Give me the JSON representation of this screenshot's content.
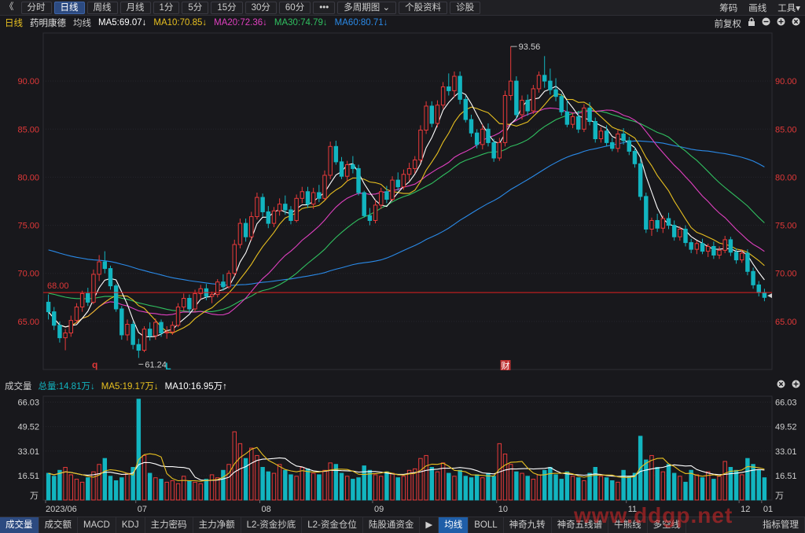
{
  "toolbar": {
    "back": "《",
    "items": [
      "分时",
      "日线",
      "周线",
      "月线",
      "1分",
      "5分",
      "15分",
      "30分",
      "60分",
      "•••",
      "多周期图 ⌄",
      "个股资料",
      "诊股"
    ],
    "active_index": 1,
    "right": [
      "筹码",
      "画线",
      "工具▾"
    ]
  },
  "legend": {
    "period": "日线",
    "stock": "药明康德",
    "avg": "均线",
    "ma5": "MA5:69.07↓",
    "ma10": "MA10:70.85↓",
    "ma20": "MA20:72.36↓",
    "ma30": "MA30:74.79↓",
    "ma60": "MA60:80.71↓",
    "adjust": "前复权",
    "lock_icon": "lock-icon",
    "icons": [
      "lock-icon",
      "minus-circle-icon",
      "plus-circle-icon",
      "close-circle-icon"
    ]
  },
  "colors": {
    "up": "#e83a3a",
    "down": "#12b5c0",
    "ma5": "#ffffff",
    "ma10": "#e8c020",
    "ma20": "#e040c0",
    "ma30": "#30c060",
    "ma60": "#2a8ae8",
    "ref_line": "#e02020"
  },
  "chart_data": [
    {
      "type": "candlestick",
      "title": "药明康德 日线",
      "y_ticks": [
        "90.00",
        "85.00",
        "80.00",
        "75.00",
        "70.00",
        "65.00"
      ],
      "ylim": [
        60,
        95
      ],
      "x_labels": [
        "2023/06",
        "07",
        "08",
        "09",
        "10",
        "11",
        "12",
        "01"
      ],
      "annotations": {
        "high": "93.56",
        "low": "61.24",
        "ref_price": "68.00",
        "marker_q": "q",
        "marker_L": "L",
        "marker_cai": "财"
      },
      "ohlc": [
        [
          67.0,
          67.8,
          65.2,
          66.0
        ],
        [
          66.0,
          66.5,
          64.1,
          64.6
        ],
        [
          64.6,
          65.0,
          62.8,
          63.3
        ],
        [
          63.3,
          64.2,
          62.0,
          63.8
        ],
        [
          63.8,
          65.6,
          63.4,
          65.1
        ],
        [
          65.1,
          66.9,
          64.8,
          66.5
        ],
        [
          66.5,
          68.2,
          66.0,
          67.9
        ],
        [
          67.9,
          68.5,
          66.6,
          67.0
        ],
        [
          67.0,
          70.4,
          66.8,
          69.9
        ],
        [
          69.9,
          71.9,
          69.2,
          71.2
        ],
        [
          71.2,
          72.3,
          70.0,
          70.5
        ],
        [
          70.5,
          70.8,
          68.3,
          68.7
        ],
        [
          68.7,
          68.9,
          66.0,
          66.3
        ],
        [
          66.3,
          66.6,
          63.1,
          63.6
        ],
        [
          63.6,
          65.2,
          63.0,
          64.7
        ],
        [
          64.7,
          65.0,
          62.1,
          62.6
        ],
        [
          62.6,
          63.2,
          61.2,
          62.0
        ],
        [
          62.0,
          64.5,
          61.8,
          64.2
        ],
        [
          64.2,
          64.9,
          63.0,
          63.5
        ],
        [
          63.5,
          65.3,
          63.1,
          64.9
        ],
        [
          64.9,
          65.2,
          63.4,
          63.8
        ],
        [
          63.8,
          64.5,
          63.2,
          63.9
        ],
        [
          63.9,
          65.0,
          63.6,
          64.6
        ],
        [
          64.6,
          66.9,
          64.4,
          66.5
        ],
        [
          66.5,
          67.9,
          66.1,
          67.4
        ],
        [
          67.4,
          67.8,
          65.9,
          66.3
        ],
        [
          66.3,
          68.3,
          66.0,
          67.9
        ],
        [
          67.9,
          68.8,
          67.3,
          68.4
        ],
        [
          68.4,
          68.9,
          67.2,
          67.6
        ],
        [
          67.6,
          68.1,
          66.9,
          67.8
        ],
        [
          67.8,
          69.4,
          67.5,
          69.1
        ],
        [
          69.1,
          69.9,
          68.2,
          68.6
        ],
        [
          68.6,
          70.3,
          68.4,
          70.0
        ],
        [
          70.0,
          73.5,
          69.7,
          73.0
        ],
        [
          73.0,
          75.7,
          72.6,
          75.2
        ],
        [
          75.2,
          75.7,
          73.3,
          73.8
        ],
        [
          73.8,
          76.4,
          73.4,
          75.9
        ],
        [
          75.9,
          78.4,
          75.6,
          77.9
        ],
        [
          77.9,
          78.3,
          75.9,
          76.4
        ],
        [
          76.4,
          77.0,
          74.7,
          75.2
        ],
        [
          75.2,
          76.9,
          74.8,
          76.5
        ],
        [
          76.5,
          77.8,
          76.0,
          77.2
        ],
        [
          77.2,
          78.1,
          76.1,
          76.6
        ],
        [
          76.6,
          77.0,
          75.1,
          75.5
        ],
        [
          75.5,
          78.2,
          75.3,
          77.8
        ],
        [
          77.8,
          79.0,
          77.3,
          78.5
        ],
        [
          78.5,
          79.0,
          76.8,
          77.2
        ],
        [
          77.2,
          78.9,
          76.7,
          78.4
        ],
        [
          78.4,
          79.2,
          77.4,
          77.8
        ],
        [
          77.8,
          80.7,
          77.6,
          80.2
        ],
        [
          80.2,
          83.7,
          79.8,
          83.2
        ],
        [
          83.2,
          83.8,
          81.3,
          81.6
        ],
        [
          81.6,
          82.1,
          79.8,
          80.1
        ],
        [
          80.1,
          81.7,
          79.6,
          81.3
        ],
        [
          81.3,
          82.2,
          80.4,
          80.9
        ],
        [
          80.9,
          81.3,
          78.1,
          78.4
        ],
        [
          78.4,
          78.6,
          75.8,
          76.0
        ],
        [
          76.0,
          76.8,
          75.0,
          75.5
        ],
        [
          75.5,
          77.6,
          75.2,
          77.1
        ],
        [
          77.1,
          78.9,
          76.7,
          78.5
        ],
        [
          78.5,
          79.1,
          77.3,
          77.7
        ],
        [
          77.7,
          80.1,
          77.5,
          79.7
        ],
        [
          79.7,
          80.5,
          78.6,
          79.0
        ],
        [
          79.0,
          80.8,
          78.7,
          80.3
        ],
        [
          80.3,
          81.5,
          79.6,
          80.9
        ],
        [
          80.9,
          82.2,
          80.4,
          81.8
        ],
        [
          81.8,
          85.4,
          81.5,
          84.9
        ],
        [
          84.9,
          87.9,
          84.5,
          87.4
        ],
        [
          87.4,
          87.9,
          85.2,
          85.6
        ],
        [
          85.6,
          88.0,
          85.2,
          87.5
        ],
        [
          87.5,
          89.9,
          87.1,
          89.4
        ],
        [
          89.4,
          90.8,
          88.5,
          89.0
        ],
        [
          89.0,
          91.0,
          88.3,
          90.5
        ],
        [
          90.5,
          91.0,
          87.6,
          88.1
        ],
        [
          88.1,
          88.5,
          85.7,
          86.0
        ],
        [
          86.0,
          86.5,
          84.2,
          84.6
        ],
        [
          84.6,
          85.0,
          83.0,
          83.4
        ],
        [
          83.4,
          85.5,
          82.9,
          85.0
        ],
        [
          85.0,
          85.6,
          83.2,
          83.6
        ],
        [
          83.6,
          84.0,
          81.6,
          82.0
        ],
        [
          82.0,
          84.1,
          81.7,
          83.6
        ],
        [
          83.6,
          89.0,
          83.2,
          88.5
        ],
        [
          88.5,
          93.6,
          88.0,
          90.0
        ],
        [
          90.0,
          90.5,
          86.1,
          86.5
        ],
        [
          86.5,
          88.5,
          86.0,
          88.0
        ],
        [
          88.0,
          88.6,
          86.4,
          86.9
        ],
        [
          86.9,
          89.6,
          86.6,
          89.2
        ],
        [
          89.2,
          91.0,
          88.8,
          90.6
        ],
        [
          90.6,
          92.6,
          89.3,
          90.0
        ],
        [
          90.0,
          91.3,
          88.6,
          89.1
        ],
        [
          89.1,
          90.3,
          87.9,
          88.4
        ],
        [
          88.4,
          88.7,
          86.4,
          86.8
        ],
        [
          86.8,
          88.0,
          85.2,
          85.5
        ],
        [
          85.5,
          86.7,
          85.1,
          86.3
        ],
        [
          86.3,
          86.9,
          84.6,
          85.0
        ],
        [
          85.0,
          87.6,
          84.7,
          87.2
        ],
        [
          87.2,
          87.8,
          85.4,
          85.8
        ],
        [
          85.8,
          86.2,
          83.6,
          84.0
        ],
        [
          84.0,
          85.2,
          83.6,
          84.8
        ],
        [
          84.8,
          85.4,
          83.2,
          83.6
        ],
        [
          83.6,
          84.1,
          82.7,
          83.0
        ],
        [
          83.0,
          84.9,
          82.6,
          84.5
        ],
        [
          84.5,
          85.1,
          83.4,
          83.8
        ],
        [
          83.8,
          84.2,
          82.3,
          82.7
        ],
        [
          82.7,
          83.1,
          81.0,
          81.4
        ],
        [
          81.4,
          81.9,
          77.6,
          78.0
        ],
        [
          78.0,
          78.4,
          74.2,
          74.6
        ],
        [
          74.6,
          75.8,
          73.9,
          75.5
        ],
        [
          75.5,
          76.2,
          74.3,
          74.7
        ],
        [
          74.7,
          76.0,
          74.2,
          75.7
        ],
        [
          75.7,
          76.3,
          74.6,
          75.0
        ],
        [
          75.0,
          75.5,
          73.4,
          73.8
        ],
        [
          73.8,
          74.9,
          73.4,
          74.6
        ],
        [
          74.6,
          75.0,
          72.8,
          73.2
        ],
        [
          73.2,
          73.6,
          72.1,
          72.5
        ],
        [
          72.5,
          73.4,
          72.0,
          73.1
        ],
        [
          73.1,
          73.6,
          72.0,
          72.3
        ],
        [
          72.3,
          73.1,
          71.7,
          72.8
        ],
        [
          72.8,
          73.3,
          71.5,
          71.9
        ],
        [
          71.9,
          72.8,
          71.5,
          72.4
        ],
        [
          72.4,
          73.9,
          72.1,
          73.5
        ],
        [
          73.5,
          73.8,
          71.8,
          72.2
        ],
        [
          72.2,
          72.6,
          71.0,
          71.4
        ],
        [
          71.4,
          72.5,
          71.1,
          72.1
        ],
        [
          72.1,
          72.5,
          69.8,
          70.2
        ],
        [
          70.2,
          70.6,
          68.4,
          68.8
        ],
        [
          68.8,
          69.2,
          67.6,
          68.0
        ],
        [
          68.0,
          68.4,
          67.1,
          67.5
        ]
      ],
      "ma_series": {
        "ma5_last": 69.07,
        "ma10_last": 70.85,
        "ma20_last": 72.36,
        "ma30_last": 74.79,
        "ma60_last": 80.71
      }
    },
    {
      "type": "bar",
      "title": "成交量",
      "y_ticks": [
        "66.03",
        "49.52",
        "33.01",
        "16.51"
      ],
      "unit": "万",
      "ylim": [
        0,
        70
      ],
      "values": [
        18,
        16,
        20,
        22,
        17,
        14,
        12,
        15,
        19,
        24,
        28,
        16,
        13,
        15,
        18,
        22,
        68,
        30,
        18,
        15,
        14,
        12,
        13,
        11,
        16,
        13,
        12,
        11,
        14,
        17,
        15,
        20,
        24,
        46,
        38,
        28,
        35,
        30,
        22,
        19,
        18,
        24,
        20,
        17,
        16,
        22,
        21,
        18,
        17,
        20,
        25,
        24,
        18,
        16,
        14,
        15,
        23,
        20,
        17,
        16,
        19,
        18,
        15,
        16,
        20,
        21,
        28,
        30,
        22,
        19,
        25,
        18,
        16,
        20,
        16,
        15,
        17,
        15,
        18,
        16,
        38,
        31,
        24,
        19,
        18,
        16,
        14,
        17,
        20,
        22,
        17,
        14,
        19,
        16,
        15,
        13,
        18,
        22,
        16,
        15,
        13,
        12,
        20,
        16,
        18,
        43,
        27,
        30,
        22,
        19,
        24,
        18,
        16,
        12,
        20,
        17,
        15,
        19,
        14,
        16,
        26,
        22,
        20,
        17,
        28,
        24,
        20,
        15
      ],
      "legend": {
        "label": "成交量",
        "total": "总量:14.81万↓",
        "ma5": "MA5:19.17万↓",
        "ma10": "MA10:16.95万↑"
      },
      "icons": [
        "close-circle-icon",
        "plus-circle-icon"
      ]
    }
  ],
  "bottom_tabs": [
    "成交量",
    "成交额",
    "MACD",
    "KDJ",
    "主力密码",
    "主力净额",
    "L2-资金抄底",
    "L2-资金仓位",
    "陆股通资金",
    "▶",
    "均线",
    "BOLL",
    "神奇九转",
    "神奇五线谱",
    "牛熊线",
    "多空线",
    "",
    "指标管理"
  ],
  "watermark": "www.ddgp.net"
}
